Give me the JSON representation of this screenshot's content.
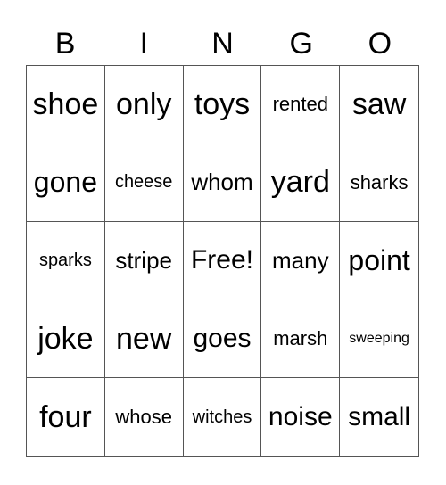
{
  "header": [
    "B",
    "I",
    "N",
    "G",
    "O"
  ],
  "cells": [
    "shoe",
    "only",
    "toys",
    "rented",
    "saw",
    "gone",
    "cheese",
    "whom",
    "yard",
    "sharks",
    "sparks",
    "stripe",
    "Free!",
    "many",
    "point",
    "joke",
    "new",
    "goes",
    "marsh",
    "sweeping",
    "four",
    "whose",
    "witches",
    "noise",
    "small"
  ]
}
